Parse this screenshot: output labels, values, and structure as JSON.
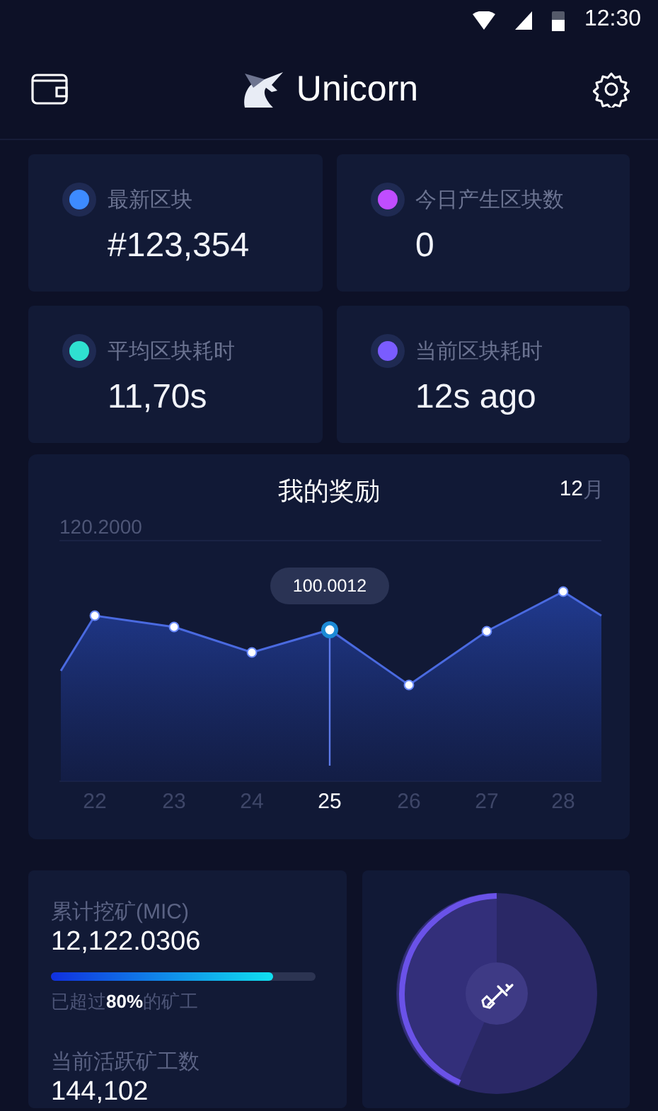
{
  "status_bar": {
    "time": "12:30"
  },
  "header": {
    "title": "Unicorn"
  },
  "stats": [
    {
      "label": "最新区块",
      "value": "#123,354",
      "color": "#3d8bff"
    },
    {
      "label": "今日产生区块数",
      "value": "0",
      "color": "#c04dff"
    },
    {
      "label": "平均区块耗时",
      "value": "11,70s",
      "color": "#2fe0d0"
    },
    {
      "label": "当前区块耗时",
      "value": "12s ago",
      "color": "#7a5cff"
    }
  ],
  "rewards": {
    "title": "我的奖励",
    "month_number": "12",
    "month_unit": "月",
    "top_value": "120.2000",
    "tooltip": "100.0012",
    "days": [
      {
        "label": "22",
        "selected": false
      },
      {
        "label": "23",
        "selected": false
      },
      {
        "label": "24",
        "selected": false
      },
      {
        "label": "25",
        "selected": true
      },
      {
        "label": "26",
        "selected": false
      },
      {
        "label": "27",
        "selected": false
      },
      {
        "label": "28",
        "selected": false
      }
    ]
  },
  "mining": {
    "total_label": "累计挖矿(MIC)",
    "total_value": "12,122.0306",
    "level": 0.84,
    "rank_text": "已超过**80%**的矿工",
    "active_label": "当前活跃矿工数",
    "active_value": "144,102"
  }
}
